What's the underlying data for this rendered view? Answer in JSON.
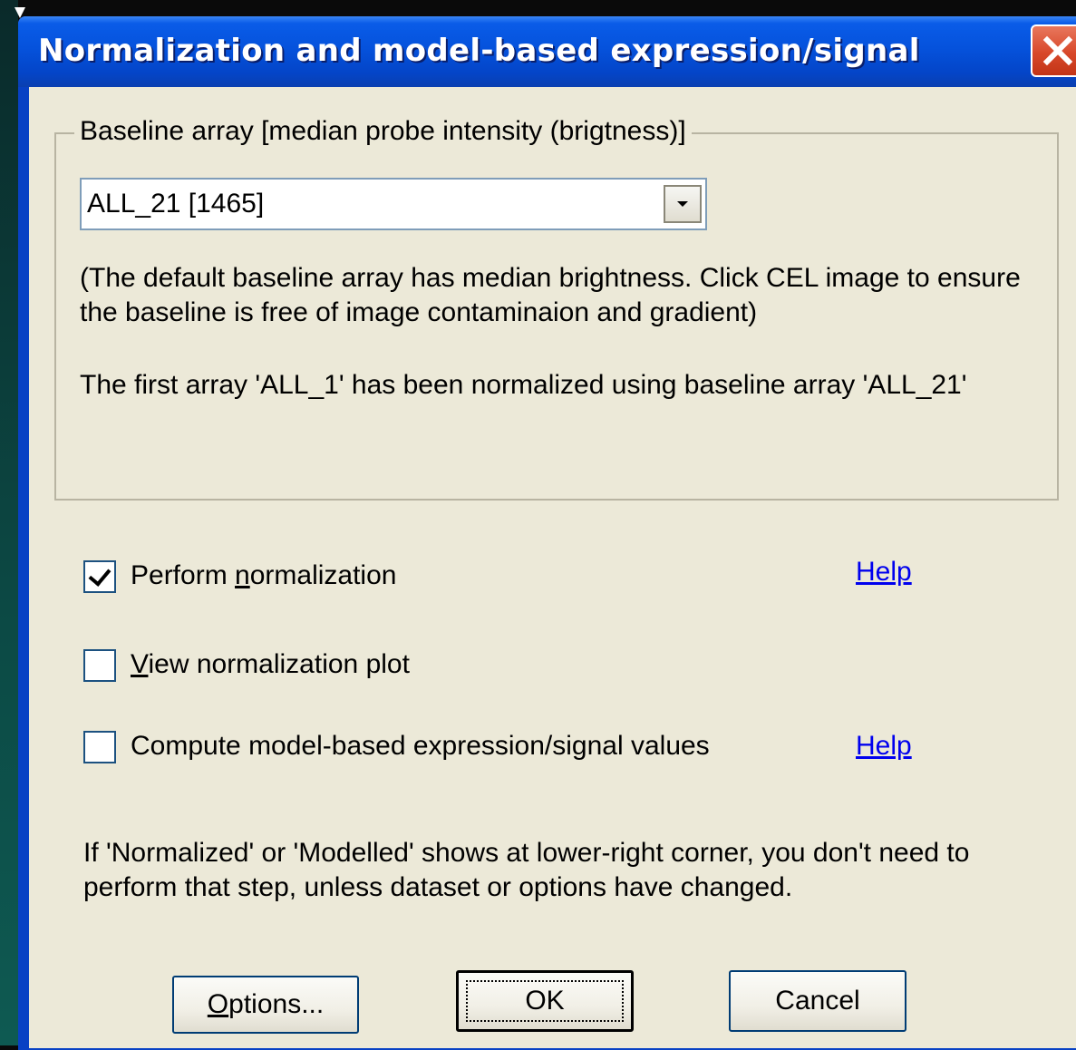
{
  "window": {
    "title": "Normalization and model-based expression/signal"
  },
  "baseline_group": {
    "legend": "Baseline array [median probe intensity (brigtness)]",
    "combo_value": "ALL_21 [1465]",
    "note_line1": "(The default baseline array has median brightness. Click CEL image to ensure",
    "note_line2": "the baseline is free of image contaminaion and gradient)",
    "status_text": "The first array 'ALL_1' has been normalized using baseline array 'ALL_21'"
  },
  "options": {
    "perform_normalization": {
      "label_pre": "Perform ",
      "label_acc": "n",
      "label_post": "ormalization",
      "checked": true
    },
    "view_plot": {
      "label_pre": "",
      "label_acc": "V",
      "label_post": "iew normalization plot",
      "checked": false
    },
    "compute_model": {
      "label_pre": "Compute model-based expression/signal values",
      "label_acc": "",
      "label_post": "",
      "checked": false
    },
    "help_label_1": "Help",
    "help_label_2": "Help"
  },
  "footer_note": {
    "line1": "If 'Normalized' or 'Modelled' shows at lower-right corner, you don't need to",
    "line2": "perform that step, unless dataset or options have changed."
  },
  "buttons": {
    "options_acc": "O",
    "options_rest": "ptions...",
    "ok": "OK",
    "cancel": "Cancel"
  }
}
